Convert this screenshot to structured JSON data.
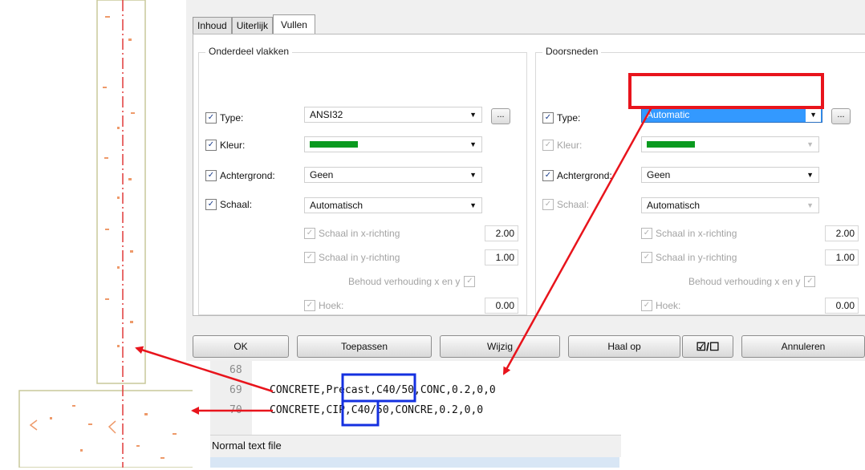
{
  "dialog": {
    "tabs": [
      "Inhoud",
      "Uiterlijk",
      "Vullen"
    ],
    "active_tab": "Vullen",
    "left_group": {
      "title": "Onderdeel vlakken",
      "type_label": "Type:",
      "type_value": "ANSI32",
      "color_label": "Kleur:",
      "background_label": "Achtergrond:",
      "background_value": "Geen",
      "scale_label": "Schaal:",
      "scale_value": "Automatisch",
      "scale_x_label": "Schaal in x-richting",
      "scale_x_value": "2.00",
      "scale_y_label": "Schaal in y-richting",
      "scale_y_value": "1.00",
      "keep_ratio_label": "Behoud verhouding x en y",
      "angle_label": "Hoek:",
      "angle_value": "0.00",
      "browse_label": "..."
    },
    "right_group": {
      "title": "Doorsneden",
      "type_label": "Type:",
      "type_value": "Automatic",
      "color_label": "Kleur:",
      "background_label": "Achtergrond:",
      "background_value": "Geen",
      "scale_label": "Schaal:",
      "scale_value": "Automatisch",
      "scale_x_label": "Schaal in x-richting",
      "scale_x_value": "2.00",
      "scale_y_label": "Schaal in y-richting",
      "scale_y_value": "1.00",
      "keep_ratio_label": "Behoud verhouding x en y",
      "angle_label": "Hoek:",
      "angle_value": "0.00",
      "browse_label": "..."
    },
    "buttons": {
      "ok": "OK",
      "apply": "Toepassen",
      "modify": "Wijzig",
      "retrieve": "Haal op",
      "toggle": "☑/☐",
      "cancel": "Annuleren"
    },
    "checkmark": "✓",
    "swatch_color": "#0a9a1f"
  },
  "editor": {
    "lines": [
      {
        "number": "68",
        "text": ""
      },
      {
        "number": "69",
        "text": "CONCRETE,Precast,C40/50,CONC,0.2,0,0"
      },
      {
        "number": "70",
        "text": "CONCRETE,CIP,C40/50,CONCRE,0.2,0,0"
      }
    ],
    "status": "Normal text file"
  },
  "annotation_colors": {
    "arrow": "#e8141c",
    "highlight_red": "#e8141c",
    "highlight_blue": "#1430e0"
  }
}
